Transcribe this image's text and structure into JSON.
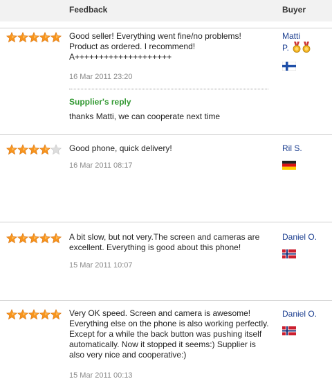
{
  "header": {
    "feedback_label": "Feedback",
    "buyer_label": "Buyer"
  },
  "colors": {
    "star_full": "#f7941d",
    "star_empty": "#d9d9d9",
    "reply_green": "#339933",
    "buyer_blue": "#1a3d8f"
  },
  "reviews": [
    {
      "rating": 5,
      "text": "Good seller! Everything went fine/no problems! Product as ordered. I recommend! A++++++++++++++++++++",
      "date": "16 Mar 2011 23:20",
      "reply_title": "Supplier's reply",
      "reply_text": "thanks Matti, we can cooperate next time",
      "buyer_name_line1": "Matti",
      "buyer_name_line2": "P.",
      "flag": "finland-flag-icon"
    },
    {
      "rating": 4,
      "text": "Good phone, quick delivery!",
      "date": "16 Mar 2011 08:17",
      "buyer_name": "Ril S.",
      "flag": "germany-flag-icon"
    },
    {
      "rating": 5,
      "text": "A bit slow, but not very.The screen and cameras are excellent. Everything is good about this phone!",
      "date": "15 Mar 2011 10:07",
      "buyer_name": "Daniel O.",
      "flag": "norway-flag-icon"
    },
    {
      "rating": 5,
      "text": "Very OK speed. Screen and camera is awesome! Everything else on the phone is also working perfectly. Except for a while the back button was pushing itself automatically. Now it stopped it seems:) Supplier is also very nice and cooperative:)",
      "date": "15 Mar 2011 00:13",
      "buyer_name": "Daniel O.",
      "flag": "norway-flag-icon"
    }
  ]
}
